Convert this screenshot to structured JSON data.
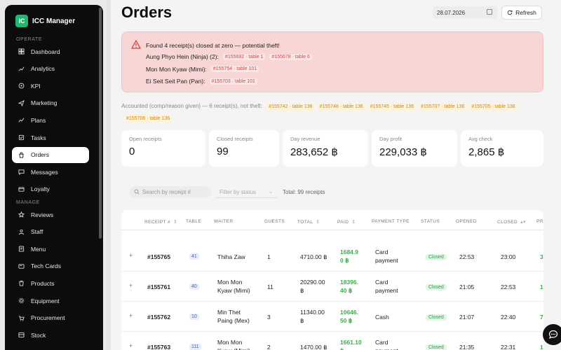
{
  "app": {
    "name": "ICC Manager",
    "logo_text": "IC"
  },
  "sidebar": {
    "operate_label": "OPERATE",
    "manage_label": "MANAGE",
    "operate_items": [
      {
        "label": "Dashboard",
        "icon": "dashboard-icon"
      },
      {
        "label": "Analytics",
        "icon": "analytics-icon"
      },
      {
        "label": "KPI",
        "icon": "kpi-icon"
      },
      {
        "label": "Marketing",
        "icon": "marketing-icon"
      },
      {
        "label": "Plans",
        "icon": "plans-icon"
      },
      {
        "label": "Tasks",
        "icon": "tasks-icon"
      },
      {
        "label": "Orders",
        "icon": "orders-icon",
        "active": true
      },
      {
        "label": "Messages",
        "icon": "messages-icon"
      },
      {
        "label": "Loyalty",
        "icon": "loyalty-icon"
      }
    ],
    "manage_items": [
      {
        "label": "Reviews",
        "icon": "star-icon"
      },
      {
        "label": "Staff",
        "icon": "staff-icon"
      },
      {
        "label": "Menu",
        "icon": "menu-icon"
      },
      {
        "label": "Tech Cards",
        "icon": "tech-cards-icon"
      },
      {
        "label": "Products",
        "icon": "products-icon"
      },
      {
        "label": "Equipment",
        "icon": "equipment-icon"
      },
      {
        "label": "Procurement",
        "icon": "procurement-icon"
      },
      {
        "label": "Stock",
        "icon": "stock-icon"
      }
    ]
  },
  "header": {
    "title": "Orders",
    "date": "28.07.2026",
    "refresh_label": "Refresh"
  },
  "alert": {
    "title": "Found 4 receipt(s) closed at zero — potential theft!",
    "rows": [
      {
        "name": "Aung Phyo Hein (Ninja) (2):",
        "tags": [
          "#155692 · table 1",
          "#155678 · table 6"
        ]
      },
      {
        "name": "Mon Mon Kyaw (Mimi):",
        "tags": [
          "#155754 · table 101"
        ]
      },
      {
        "name": "Ei Seit Seit Pan (Pan):",
        "tags": [
          "#155703 · table 101"
        ]
      }
    ]
  },
  "accounted": {
    "text": "Accounted (comp/reason given) — 6 receipt(s), not theft:",
    "tags": [
      "#155742 · table 136",
      "#155748 · table 136",
      "#155745 · table 136",
      "#155707 · table 136",
      "#155705 · table 136",
      "#155706 · table 136"
    ]
  },
  "stats": [
    {
      "label": "Open receipts",
      "value": "0"
    },
    {
      "label": "Closed receipts",
      "value": "99"
    },
    {
      "label": "Day revenue",
      "value": "283,652 ฿"
    },
    {
      "label": "Day profit",
      "value": "229,033 ฿"
    },
    {
      "label": "Avg check",
      "value": "2,865 ฿"
    }
  ],
  "filters": {
    "search_placeholder": "Search by receipt #",
    "status_placeholder": "Filter by status",
    "total": "Total: 99 receipts"
  },
  "table": {
    "headers": [
      "RECEIPT #",
      "TABLE",
      "WAITER",
      "GUESTS",
      "TOTAL",
      "PAID",
      "PAYMENT TYPE",
      "STATUS",
      "OPENED",
      "CLOSED",
      "PR"
    ],
    "rows": [
      {
        "expand": "+",
        "receipt": "#155765",
        "table": "41",
        "waiter": [
          "Thiha Zaw",
          ""
        ],
        "guests": "1",
        "total": [
          "4710.00 ฿",
          ""
        ],
        "paid": [
          "1684.9",
          "0 ฿"
        ],
        "payment": [
          "Card",
          "payment"
        ],
        "status": "Closed",
        "opened": "22:53",
        "closed": "23:00",
        "extra": "3"
      },
      {
        "expand": "+",
        "receipt": "#155761",
        "table": "40",
        "waiter": [
          "Mon Mon",
          "Kyaw (Mimi)"
        ],
        "guests": "11",
        "total": [
          "20290.00",
          "฿"
        ],
        "paid": [
          "18396.",
          "40 ฿"
        ],
        "payment": [
          "Card",
          "payment"
        ],
        "status": "Closed",
        "opened": "21:05",
        "closed": "22:53",
        "extra": "1"
      },
      {
        "expand": "+",
        "receipt": "#155762",
        "table": "10",
        "waiter": [
          "Min Thet",
          "Paing (Mex)"
        ],
        "guests": "3",
        "total": [
          "11340.00",
          "฿"
        ],
        "paid": [
          "10646.",
          "50 ฿"
        ],
        "payment": [
          "Cash",
          ""
        ],
        "status": "Closed",
        "opened": "21:07",
        "closed": "22:40",
        "extra": "7"
      },
      {
        "expand": "+",
        "receipt": "#155763",
        "table": "111",
        "waiter": [
          "Mon Mon",
          "Kyaw (Mimi)"
        ],
        "guests": "2",
        "total": [
          "1470.00 ฿",
          ""
        ],
        "paid": [
          "1661.10",
          "฿"
        ],
        "payment": [
          "Card",
          "payment"
        ],
        "status": "Closed",
        "opened": "21:35",
        "closed": "22:31",
        "extra": "1"
      }
    ]
  }
}
